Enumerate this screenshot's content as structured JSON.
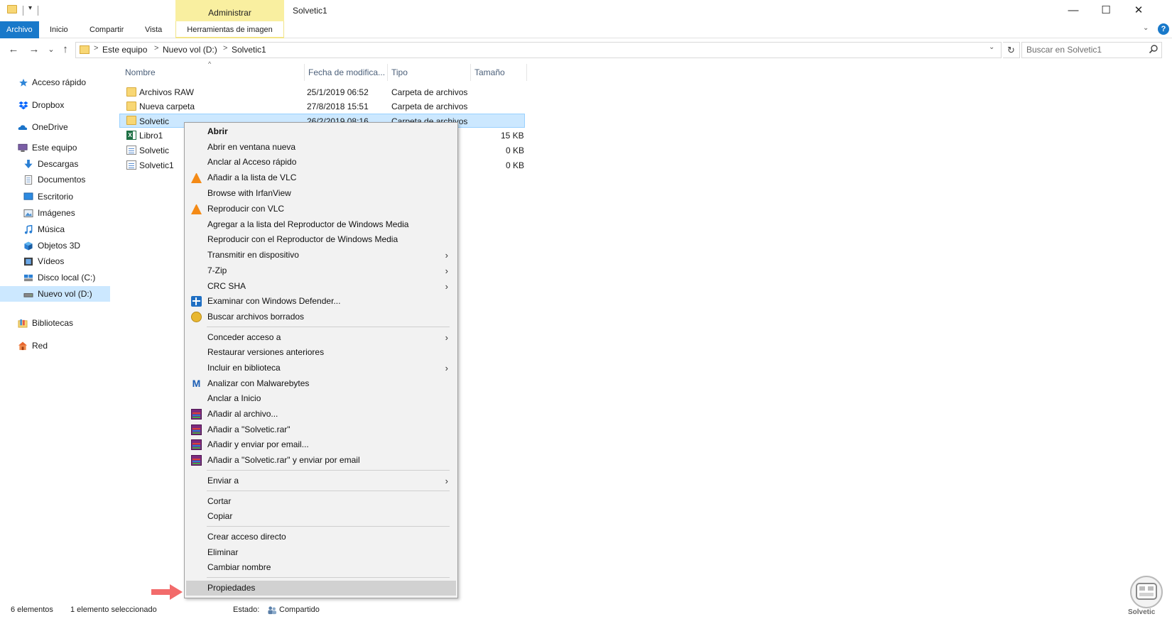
{
  "window": {
    "title": "Solvetic1",
    "context_tab_header": "Administrar",
    "controls": {
      "minimize": "—",
      "maximize": "☐",
      "close": "✕"
    }
  },
  "quick_access": {
    "dropdown": "▾"
  },
  "ribbon": {
    "tabs": [
      "Archivo",
      "Inicio",
      "Compartir",
      "Vista",
      "Herramientas de imagen"
    ],
    "collapse": "⌄",
    "help": "?"
  },
  "navigation": {
    "back": "←",
    "forward": "→",
    "recent": "⌄",
    "up": "↑",
    "breadcrumb": [
      "Este equipo",
      "Nuevo vol (D:)",
      "Solvetic1"
    ],
    "separator": ">",
    "dropdown": "⌄",
    "refresh": "↻",
    "search_placeholder": "Buscar en Solvetic1"
  },
  "sidebar": {
    "items": [
      {
        "label": "Acceso rápido",
        "icon": "star-icon"
      },
      {
        "label": "Dropbox",
        "icon": "dropbox-icon"
      },
      {
        "label": "OneDrive",
        "icon": "cloud-icon"
      },
      {
        "label": "Este equipo",
        "icon": "computer-icon"
      },
      {
        "label": "Descargas",
        "icon": "download-icon"
      },
      {
        "label": "Documentos",
        "icon": "document-icon"
      },
      {
        "label": "Escritorio",
        "icon": "desktop-icon"
      },
      {
        "label": "Imágenes",
        "icon": "pictures-icon"
      },
      {
        "label": "Música",
        "icon": "music-icon"
      },
      {
        "label": "Objetos 3D",
        "icon": "cube-icon"
      },
      {
        "label": "Vídeos",
        "icon": "video-icon"
      },
      {
        "label": "Disco local (C:)",
        "icon": "drive-icon"
      },
      {
        "label": "Nuevo vol (D:)",
        "icon": "drive-icon"
      },
      {
        "label": "Bibliotecas",
        "icon": "library-icon"
      },
      {
        "label": "Red",
        "icon": "network-icon"
      }
    ]
  },
  "columns": [
    "Nombre",
    "Fecha de modifica...",
    "Tipo",
    "Tamaño"
  ],
  "sort_indicator": "^",
  "files": [
    {
      "name": "Archivos RAW",
      "date": "25/1/2019 06:52",
      "type": "Carpeta de archivos",
      "size": ""
    },
    {
      "name": "Nueva carpeta",
      "date": "27/8/2018 15:51",
      "type": "Carpeta de archivos",
      "size": ""
    },
    {
      "name": "Solvetic",
      "date": "26/2/2019 08:16",
      "type": "Carpeta de archivos",
      "size": ""
    },
    {
      "name": "Libro1",
      "date": "",
      "type": "...",
      "size": "15 KB"
    },
    {
      "name": "Solvetic",
      "date": "",
      "type": "",
      "size": "0 KB"
    },
    {
      "name": "Solvetic1",
      "date": "",
      "type": "",
      "size": "0 KB"
    }
  ],
  "context_menu": {
    "items": [
      "Abrir",
      "Abrir en ventana nueva",
      "Anclar al Acceso rápido",
      "Añadir a la lista de VLC",
      "Browse with IrfanView",
      "Reproducir con VLC",
      "Agregar a la lista del Reproductor de Windows Media",
      "Reproducir con el Reproductor de Windows Media",
      "Transmitir en dispositivo",
      "7-Zip",
      "CRC SHA",
      "Examinar con Windows Defender...",
      "Buscar archivos borrados",
      "Conceder acceso a",
      "Restaurar versiones anteriores",
      "Incluir en biblioteca",
      "Analizar con Malwarebytes",
      "Anclar a Inicio",
      "Añadir al archivo...",
      "Añadir a \"Solvetic.rar\"",
      "Añadir y enviar por email...",
      "Añadir a \"Solvetic.rar\" y enviar por email",
      "Enviar a",
      "Cortar",
      "Copiar",
      "Crear acceso directo",
      "Eliminar",
      "Cambiar nombre",
      "Propiedades"
    ],
    "submenu_arrow": "›"
  },
  "status_bar": {
    "count": "6 elementos",
    "selected": "1 elemento seleccionado",
    "state_label": "Estado:",
    "state_value": "Compartido"
  },
  "watermark": {
    "text": "Solvetic"
  },
  "colors": {
    "accent": "#1979ca",
    "selection": "#cce8ff",
    "context_tab": "#f9efa0",
    "menu_highlight": "#d1d1d1",
    "annotation_arrow": "#f26b6b"
  }
}
